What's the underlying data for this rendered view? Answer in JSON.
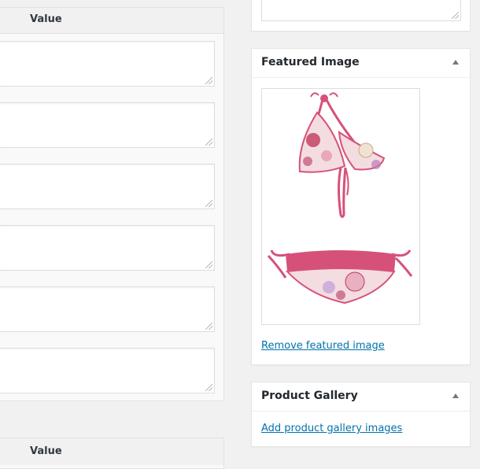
{
  "custom_fields": {
    "value_header": "Value",
    "field_count": 6,
    "second_value_header": "Value"
  },
  "featured_image": {
    "title": "Featured Image",
    "remove_link": "Remove featured image",
    "image_alt": "Pink floral halter bikini with ruffled bottom"
  },
  "product_gallery": {
    "title": "Product Gallery",
    "add_link": "Add product gallery images"
  },
  "colors": {
    "link": "#0073aa",
    "bikini_pink": "#d6517a",
    "bikini_light": "#f3dde0"
  }
}
